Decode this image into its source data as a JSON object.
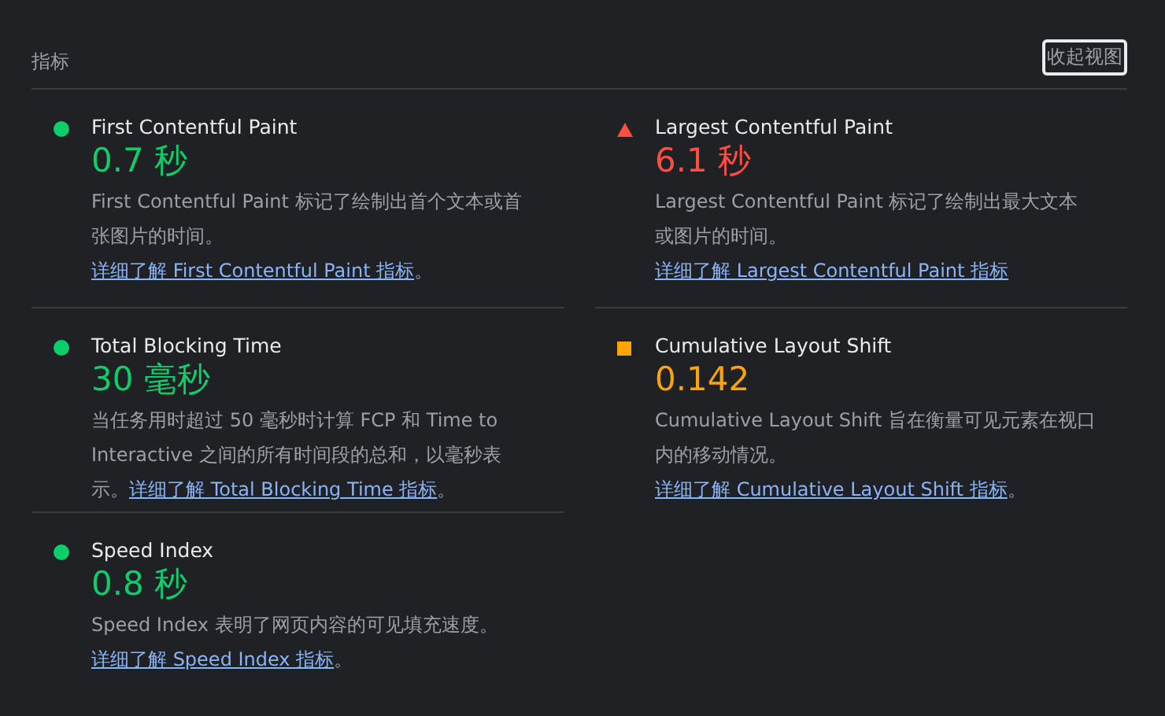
{
  "header": {
    "title": "指标",
    "toggle_button": "收起视图"
  },
  "metrics": [
    {
      "kind": "pass",
      "title": "First Contentful Paint",
      "value": "0.7 秒",
      "description": "First Contentful Paint 标记了绘制出首个文本或首张图片的时间。",
      "link": "详细了解 First Contentful Paint 指标",
      "suffix": "。"
    },
    {
      "kind": "fail",
      "title": "Largest Contentful Paint",
      "value": "6.1 秒",
      "description": "Largest Contentful Paint 标记了绘制出最大文本或图片的时间。",
      "link": "详细了解 Largest Contentful Paint 指标"
    },
    {
      "kind": "pass",
      "title": "Total Blocking Time",
      "value": "30 毫秒",
      "description": "当任务用时超过 50 毫秒时计算 FCP 和 Time to Interactive 之间的所有时间段的总和，以毫秒表示。",
      "link": "详细了解 Total Blocking Time 指标",
      "suffix": "。"
    },
    {
      "kind": "average",
      "title": "Cumulative Layout Shift",
      "value": "0.142",
      "description": "Cumulative Layout Shift 旨在衡量可见元素在视口内的移动情况。",
      "link": "详细了解 Cumulative Layout Shift 指标",
      "suffix": "。"
    },
    {
      "kind": "pass",
      "title": "Speed Index",
      "value": "0.8 秒",
      "description": "Speed Index 表明了网页内容的可见填充速度。",
      "link": "详细了解 Speed Index 指标",
      "suffix": "。"
    }
  ]
}
